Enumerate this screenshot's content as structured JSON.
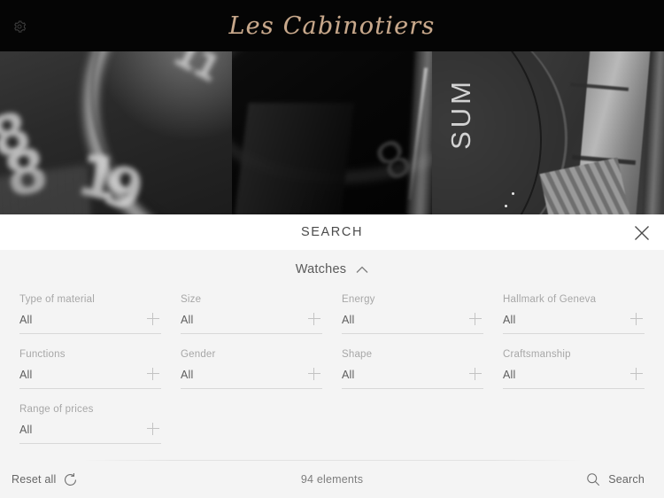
{
  "topbar": {
    "brand": "Les Cabinotiers",
    "settings_icon": "gear-icon",
    "background": "#050505",
    "brand_color": "#c9a98c"
  },
  "hero": {
    "tiles": [
      {
        "alt": "watch-dial-closeup-numerals"
      },
      {
        "alt": "watch-case-dark-closeup"
      },
      {
        "alt": "watch-bezel-bracelet-closeup"
      }
    ]
  },
  "search_panel": {
    "title": "SEARCH",
    "close_icon": "close-icon",
    "category": {
      "label": "Watches",
      "chevron_icon": "chevron-up-icon",
      "expanded": true
    },
    "filters": [
      {
        "label": "Type of material",
        "value": "All",
        "add_icon": "plus-icon"
      },
      {
        "label": "Size",
        "value": "All",
        "add_icon": "plus-icon"
      },
      {
        "label": "Energy",
        "value": "All",
        "add_icon": "plus-icon"
      },
      {
        "label": "Hallmark of Geneva",
        "value": "All",
        "add_icon": "plus-icon"
      },
      {
        "label": "Functions",
        "value": "All",
        "add_icon": "plus-icon"
      },
      {
        "label": "Gender",
        "value": "All",
        "add_icon": "plus-icon"
      },
      {
        "label": "Shape",
        "value": "All",
        "add_icon": "plus-icon"
      },
      {
        "label": "Craftsmanship",
        "value": "All",
        "add_icon": "plus-icon"
      },
      {
        "label": "Range of prices",
        "value": "All",
        "add_icon": "plus-icon"
      }
    ]
  },
  "bottom_bar": {
    "reset_label": "Reset all",
    "reset_icon": "reset-circle-icon",
    "elements_count": "94 elements",
    "search_label": "Search",
    "search_icon": "search-icon"
  },
  "colors": {
    "panel_bg": "#f4f4f4",
    "header_bg": "#ffffff",
    "underline": "#d8d8d8",
    "label_text": "#a7a7a7",
    "value_text": "#5d5d5d"
  }
}
